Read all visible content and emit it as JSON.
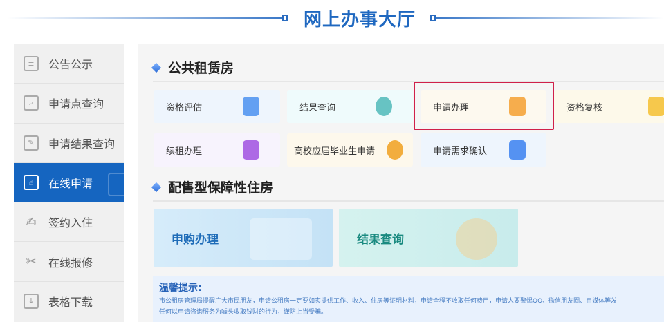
{
  "header": {
    "title": "网上办事大厅"
  },
  "sidebar": {
    "items": [
      {
        "label": "公告公示",
        "icon": "clipboard-icon"
      },
      {
        "label": "申请点查询",
        "icon": "search-doc-icon"
      },
      {
        "label": "申请结果查询",
        "icon": "edit-doc-icon"
      },
      {
        "label": "在线申请",
        "icon": "hand-doc-icon",
        "active": true
      },
      {
        "label": "签约入住",
        "icon": "pen-sign-icon"
      },
      {
        "label": "在线报修",
        "icon": "tools-icon"
      },
      {
        "label": "表格下载",
        "icon": "download-doc-icon"
      }
    ]
  },
  "public_rental": {
    "title": "公共租赁房",
    "cards": [
      {
        "label": "资格评估",
        "color": "#4a90f0"
      },
      {
        "label": "结果查询",
        "color": "#4fb8b8"
      },
      {
        "label": "申请办理",
        "color": "#f5a030"
      },
      {
        "label": "资格复核",
        "color": "#f5c030"
      },
      {
        "label": "续租办理",
        "color": "#a050e0"
      },
      {
        "label": "高校应届毕业生申请",
        "color": "#f0a020"
      },
      {
        "label": "申请需求确认",
        "color": "#3a80f0"
      }
    ]
  },
  "affordable": {
    "title": "配售型保障性住房",
    "cards": [
      {
        "label": "申购办理"
      },
      {
        "label": "结果查询"
      }
    ]
  },
  "notice": {
    "title": "温馨提示:",
    "line1": "市公租房管理局提醒广大市民朋友，申请公租房一定要如实提供工作、收入、住房等证明材料，申请全程不收取任何费用，申请人要警惕QQ、微信朋友圈、自媒体等发",
    "line2": "任何以申请咨询服务为噱头收取钱财的行为，谨防上当受骗。"
  }
}
